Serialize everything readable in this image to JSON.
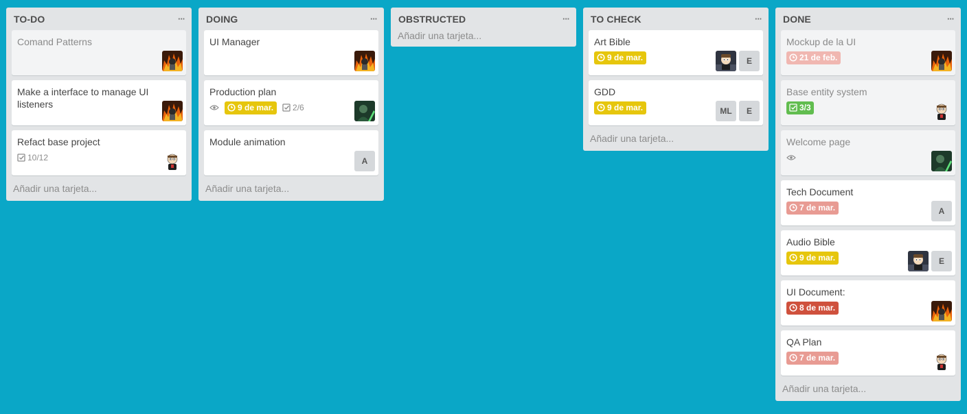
{
  "board": {
    "add_card_label": "Añadir una tarjeta...",
    "list_menu_label": "···",
    "lists": [
      {
        "title": "TO-DO",
        "cards": [
          {
            "title": "Comand Patterns",
            "faded": true,
            "members": [
              "avatar-fire"
            ]
          },
          {
            "title": "Make a interface to manage UI listeners",
            "members": [
              "avatar-fire"
            ]
          },
          {
            "title": "Refact base project",
            "checklist": "10/12",
            "members": [
              "avatar-cartoon"
            ]
          }
        ]
      },
      {
        "title": "DOING",
        "cards": [
          {
            "title": "UI Manager",
            "members": [
              "avatar-fire"
            ]
          },
          {
            "title": "Production plan",
            "watch": true,
            "due": "9 de mar.",
            "due_style": "yellow",
            "checklist": "2/6",
            "members": [
              "avatar-green"
            ]
          },
          {
            "title": "Module animation",
            "members": [
              "A"
            ]
          }
        ]
      },
      {
        "title": "OBSTRUCTED",
        "cards": []
      },
      {
        "title": "TO CHECK",
        "cards": [
          {
            "title": "Art Bible",
            "due": "9 de mar.",
            "due_style": "yellow",
            "members": [
              "avatar-cartoon-dark",
              "E"
            ]
          },
          {
            "title": "GDD",
            "due": "9 de mar.",
            "due_style": "yellow",
            "members": [
              "ML",
              "E"
            ]
          }
        ]
      },
      {
        "title": "DONE",
        "cards": [
          {
            "title": "Mockup de la UI",
            "faded": true,
            "due": "21 de feb.",
            "due_style": "done",
            "members": [
              "avatar-fire"
            ]
          },
          {
            "title": "Base entity system",
            "faded": true,
            "checklist_done": "3/3",
            "members": [
              "avatar-cartoon"
            ]
          },
          {
            "title": "Welcome page",
            "faded": true,
            "watch": true,
            "members": [
              "avatar-green"
            ]
          },
          {
            "title": "Tech Document",
            "due": "7 de mar.",
            "due_style": "pink",
            "members": [
              "A"
            ]
          },
          {
            "title": "Audio Bible",
            "due": "9 de mar.",
            "due_style": "yellow",
            "members": [
              "avatar-cartoon-dark",
              "E"
            ]
          },
          {
            "title": "UI Document:",
            "due": "8 de mar.",
            "due_style": "red",
            "members": [
              "avatar-fire"
            ]
          },
          {
            "title": "QA Plan",
            "due": "7 de mar.",
            "due_style": "pink",
            "members": [
              "avatar-cartoon"
            ]
          }
        ]
      }
    ]
  },
  "colors": {
    "background": "#0aa7c7",
    "list_bg": "#e2e4e6",
    "due_yellow": "#e6c60d",
    "due_red": "#cf513d",
    "due_pink": "#e89b93",
    "check_green": "#61bd4f"
  }
}
